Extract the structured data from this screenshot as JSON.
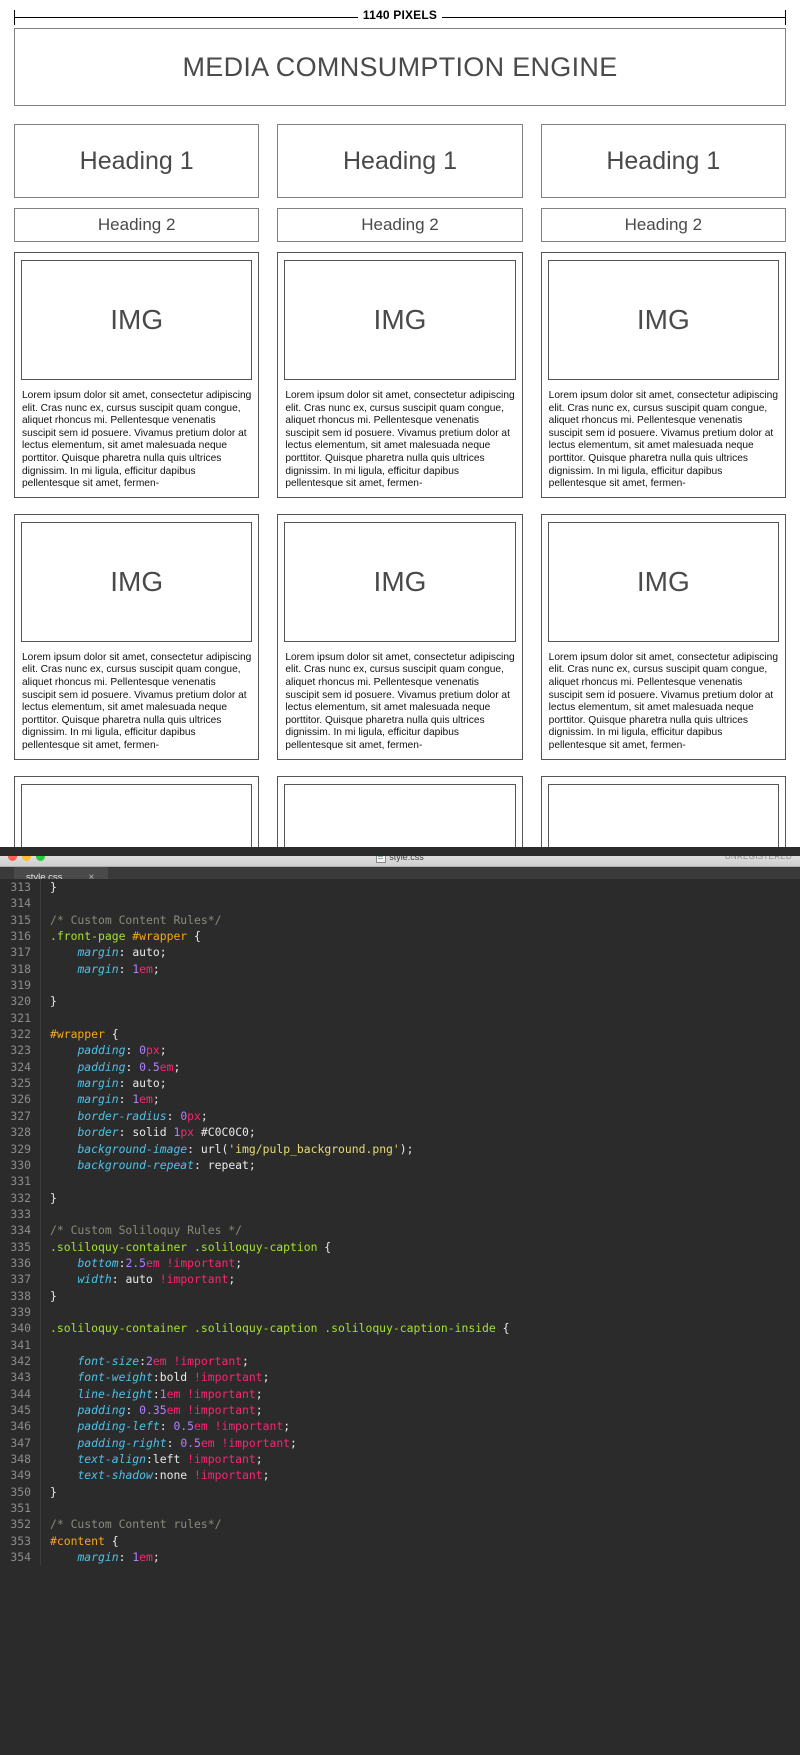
{
  "wireframe": {
    "ruler_label": "1140 PIXELS",
    "title": "MEDIA COMNSUMPTION ENGINE",
    "heading1": "Heading 1",
    "heading2": "Heading 2",
    "img_placeholder": "IMG",
    "body_text": "Lorem ipsum dolor sit amet, consectetur adipiscing elit. Cras nunc ex, cursus suscipit quam congue, aliquet rhoncus mi. Pellentesque venenatis suscipit sem id posuere. Vivamus pretium dolor at lectus elementum, sit amet malesuada neque porttitor. Quisque pharetra nulla quis ultrices dignissim. In mi ligula, efficitur dapibus pellentesque sit amet, fermen-",
    "columns": [
      {
        "heading1": "Heading 1",
        "heading2": "Heading 2"
      },
      {
        "heading1": "Heading 1",
        "heading2": "Heading 2"
      },
      {
        "heading1": "Heading 1",
        "heading2": "Heading 2"
      }
    ]
  },
  "editor": {
    "window_title": "style.css",
    "license_status": "UNREGISTERED",
    "tab_label": "style.css",
    "tab_close": "×",
    "traffic_lights": [
      "close-red",
      "minimize-yellow",
      "zoom-green"
    ],
    "first_visible_line": 313,
    "lines": [
      {
        "num": "313",
        "tokens": [
          {
            "t": "}",
            "c": "tok-punc"
          }
        ],
        "indent": 0
      },
      {
        "num": "314",
        "tokens": [],
        "indent": 0
      },
      {
        "num": "315",
        "tokens": [
          {
            "t": "/* Custom Content Rules*/",
            "c": "tok-comment"
          }
        ],
        "indent": 0
      },
      {
        "num": "316",
        "tokens": [
          {
            "t": ".front-page ",
            "c": "tok-selector-class"
          },
          {
            "t": "#wrapper",
            "c": "tok-selector-id"
          },
          {
            "t": " {",
            "c": "tok-punc"
          }
        ],
        "indent": 0
      },
      {
        "num": "317",
        "tokens": [
          {
            "t": "margin",
            "c": "tok-prop"
          },
          {
            "t": ": ",
            "c": "tok-punc"
          },
          {
            "t": "auto",
            "c": "tok-val"
          },
          {
            "t": ";",
            "c": "tok-punc"
          }
        ],
        "indent": 1
      },
      {
        "num": "318",
        "tokens": [
          {
            "t": "margin",
            "c": "tok-prop"
          },
          {
            "t": ": ",
            "c": "tok-punc"
          },
          {
            "t": "1",
            "c": "tok-num"
          },
          {
            "t": "em",
            "c": "tok-unit"
          },
          {
            "t": ";",
            "c": "tok-punc"
          }
        ],
        "indent": 1
      },
      {
        "num": "319",
        "tokens": [],
        "indent": 0
      },
      {
        "num": "320",
        "tokens": [
          {
            "t": "}",
            "c": "tok-punc"
          }
        ],
        "indent": 0
      },
      {
        "num": "321",
        "tokens": [],
        "indent": 0
      },
      {
        "num": "322",
        "tokens": [
          {
            "t": "#wrapper",
            "c": "tok-selector-id"
          },
          {
            "t": " {",
            "c": "tok-punc"
          }
        ],
        "indent": 0
      },
      {
        "num": "323",
        "tokens": [
          {
            "t": "padding",
            "c": "tok-prop"
          },
          {
            "t": ": ",
            "c": "tok-punc"
          },
          {
            "t": "0",
            "c": "tok-num"
          },
          {
            "t": "px",
            "c": "tok-unit"
          },
          {
            "t": ";",
            "c": "tok-punc"
          }
        ],
        "indent": 1
      },
      {
        "num": "324",
        "tokens": [
          {
            "t": "padding",
            "c": "tok-prop"
          },
          {
            "t": ": ",
            "c": "tok-punc"
          },
          {
            "t": "0.5",
            "c": "tok-num"
          },
          {
            "t": "em",
            "c": "tok-unit"
          },
          {
            "t": ";",
            "c": "tok-punc"
          }
        ],
        "indent": 1
      },
      {
        "num": "325",
        "tokens": [
          {
            "t": "margin",
            "c": "tok-prop"
          },
          {
            "t": ": ",
            "c": "tok-punc"
          },
          {
            "t": "auto",
            "c": "tok-val"
          },
          {
            "t": ";",
            "c": "tok-punc"
          }
        ],
        "indent": 1
      },
      {
        "num": "326",
        "tokens": [
          {
            "t": "margin",
            "c": "tok-prop"
          },
          {
            "t": ": ",
            "c": "tok-punc"
          },
          {
            "t": "1",
            "c": "tok-num"
          },
          {
            "t": "em",
            "c": "tok-unit"
          },
          {
            "t": ";",
            "c": "tok-punc"
          }
        ],
        "indent": 1
      },
      {
        "num": "327",
        "tokens": [
          {
            "t": "border-radius",
            "c": "tok-prop"
          },
          {
            "t": ": ",
            "c": "tok-punc"
          },
          {
            "t": "0",
            "c": "tok-num"
          },
          {
            "t": "px",
            "c": "tok-unit"
          },
          {
            "t": ";",
            "c": "tok-punc"
          }
        ],
        "indent": 1
      },
      {
        "num": "328",
        "tokens": [
          {
            "t": "border",
            "c": "tok-prop"
          },
          {
            "t": ": ",
            "c": "tok-punc"
          },
          {
            "t": "solid ",
            "c": "tok-val"
          },
          {
            "t": "1",
            "c": "tok-num"
          },
          {
            "t": "px",
            "c": "tok-unit"
          },
          {
            "t": " #C0C0C0",
            "c": "tok-val"
          },
          {
            "t": ";",
            "c": "tok-punc"
          }
        ],
        "indent": 1
      },
      {
        "num": "329",
        "tokens": [
          {
            "t": "background-image",
            "c": "tok-prop"
          },
          {
            "t": ": ",
            "c": "tok-punc"
          },
          {
            "t": "url(",
            "c": "tok-func"
          },
          {
            "t": "'img/pulp_background.png'",
            "c": "tok-string"
          },
          {
            "t": ");",
            "c": "tok-punc"
          }
        ],
        "indent": 1
      },
      {
        "num": "330",
        "tokens": [
          {
            "t": "background-repeat",
            "c": "tok-prop"
          },
          {
            "t": ": ",
            "c": "tok-punc"
          },
          {
            "t": "repeat",
            "c": "tok-val"
          },
          {
            "t": ";",
            "c": "tok-punc"
          }
        ],
        "indent": 1
      },
      {
        "num": "331",
        "tokens": [],
        "indent": 0
      },
      {
        "num": "332",
        "tokens": [
          {
            "t": "}",
            "c": "tok-punc"
          }
        ],
        "indent": 0
      },
      {
        "num": "333",
        "tokens": [],
        "indent": 0
      },
      {
        "num": "334",
        "tokens": [
          {
            "t": "/* Custom Soliloquy Rules */",
            "c": "tok-comment"
          }
        ],
        "indent": 0
      },
      {
        "num": "335",
        "tokens": [
          {
            "t": ".soliloquy-container .soliloquy-caption",
            "c": "tok-selector-class"
          },
          {
            "t": " {",
            "c": "tok-punc"
          }
        ],
        "indent": 0
      },
      {
        "num": "336",
        "tokens": [
          {
            "t": "bottom",
            "c": "tok-prop"
          },
          {
            "t": ":",
            "c": "tok-punc"
          },
          {
            "t": "2.5",
            "c": "tok-num"
          },
          {
            "t": "em",
            "c": "tok-unit"
          },
          {
            "t": " !important",
            "c": "tok-imp"
          },
          {
            "t": ";",
            "c": "tok-punc"
          }
        ],
        "indent": 1
      },
      {
        "num": "337",
        "tokens": [
          {
            "t": "width",
            "c": "tok-prop"
          },
          {
            "t": ": ",
            "c": "tok-punc"
          },
          {
            "t": "auto",
            "c": "tok-val"
          },
          {
            "t": " !important",
            "c": "tok-imp"
          },
          {
            "t": ";",
            "c": "tok-punc"
          }
        ],
        "indent": 1
      },
      {
        "num": "338",
        "tokens": [
          {
            "t": "}",
            "c": "tok-punc"
          }
        ],
        "indent": 0
      },
      {
        "num": "339",
        "tokens": [],
        "indent": 0
      },
      {
        "num": "340",
        "tokens": [
          {
            "t": ".soliloquy-container .soliloquy-caption .soliloquy-caption-inside",
            "c": "tok-selector-class"
          },
          {
            "t": " {",
            "c": "tok-punc"
          }
        ],
        "indent": 0
      },
      {
        "num": "341",
        "tokens": [],
        "indent": 0
      },
      {
        "num": "342",
        "tokens": [
          {
            "t": "font-size",
            "c": "tok-prop"
          },
          {
            "t": ":",
            "c": "tok-punc"
          },
          {
            "t": "2",
            "c": "tok-num"
          },
          {
            "t": "em",
            "c": "tok-unit"
          },
          {
            "t": " !important",
            "c": "tok-imp"
          },
          {
            "t": ";",
            "c": "tok-punc"
          }
        ],
        "indent": 1
      },
      {
        "num": "343",
        "tokens": [
          {
            "t": "font-weight",
            "c": "tok-prop"
          },
          {
            "t": ":",
            "c": "tok-punc"
          },
          {
            "t": "bold",
            "c": "tok-val"
          },
          {
            "t": " !important",
            "c": "tok-imp"
          },
          {
            "t": ";",
            "c": "tok-punc"
          }
        ],
        "indent": 1
      },
      {
        "num": "344",
        "tokens": [
          {
            "t": "line-height",
            "c": "tok-prop"
          },
          {
            "t": ":",
            "c": "tok-punc"
          },
          {
            "t": "1",
            "c": "tok-num"
          },
          {
            "t": "em",
            "c": "tok-unit"
          },
          {
            "t": " !important",
            "c": "tok-imp"
          },
          {
            "t": ";",
            "c": "tok-punc"
          }
        ],
        "indent": 1
      },
      {
        "num": "345",
        "tokens": [
          {
            "t": "padding",
            "c": "tok-prop"
          },
          {
            "t": ": ",
            "c": "tok-punc"
          },
          {
            "t": "0.35",
            "c": "tok-num"
          },
          {
            "t": "em",
            "c": "tok-unit"
          },
          {
            "t": " !important",
            "c": "tok-imp"
          },
          {
            "t": ";",
            "c": "tok-punc"
          }
        ],
        "indent": 1
      },
      {
        "num": "346",
        "tokens": [
          {
            "t": "padding-left",
            "c": "tok-prop"
          },
          {
            "t": ": ",
            "c": "tok-punc"
          },
          {
            "t": "0.5",
            "c": "tok-num"
          },
          {
            "t": "em",
            "c": "tok-unit"
          },
          {
            "t": " !important",
            "c": "tok-imp"
          },
          {
            "t": ";",
            "c": "tok-punc"
          }
        ],
        "indent": 1
      },
      {
        "num": "347",
        "tokens": [
          {
            "t": "padding-right",
            "c": "tok-prop"
          },
          {
            "t": ": ",
            "c": "tok-punc"
          },
          {
            "t": "0.5",
            "c": "tok-num"
          },
          {
            "t": "em",
            "c": "tok-unit"
          },
          {
            "t": " !important",
            "c": "tok-imp"
          },
          {
            "t": ";",
            "c": "tok-punc"
          }
        ],
        "indent": 1
      },
      {
        "num": "348",
        "tokens": [
          {
            "t": "text-align",
            "c": "tok-prop"
          },
          {
            "t": ":",
            "c": "tok-punc"
          },
          {
            "t": "left",
            "c": "tok-val"
          },
          {
            "t": " !important",
            "c": "tok-imp"
          },
          {
            "t": ";",
            "c": "tok-punc"
          }
        ],
        "indent": 1
      },
      {
        "num": "349",
        "tokens": [
          {
            "t": "text-shadow",
            "c": "tok-prop"
          },
          {
            "t": ":",
            "c": "tok-punc"
          },
          {
            "t": "none",
            "c": "tok-val"
          },
          {
            "t": " !important",
            "c": "tok-imp"
          },
          {
            "t": ";",
            "c": "tok-punc"
          }
        ],
        "indent": 1
      },
      {
        "num": "350",
        "tokens": [
          {
            "t": "}",
            "c": "tok-punc"
          }
        ],
        "indent": 0
      },
      {
        "num": "351",
        "tokens": [],
        "indent": 0
      },
      {
        "num": "352",
        "tokens": [
          {
            "t": "/* Custom Content rules*/",
            "c": "tok-comment"
          }
        ],
        "indent": 0
      },
      {
        "num": "353",
        "tokens": [
          {
            "t": "#content",
            "c": "tok-selector-id"
          },
          {
            "t": " {",
            "c": "tok-punc"
          }
        ],
        "indent": 0
      },
      {
        "num": "354",
        "tokens": [
          {
            "t": "margin",
            "c": "tok-prop"
          },
          {
            "t": ": ",
            "c": "tok-punc"
          },
          {
            "t": "1",
            "c": "tok-num"
          },
          {
            "t": "em",
            "c": "tok-unit"
          },
          {
            "t": ";",
            "c": "tok-punc"
          }
        ],
        "indent": 1
      }
    ]
  },
  "colors": {
    "editor_background": "#2b2b2b",
    "gutter_text": "#8c8c8c",
    "comment": "#8a8a7e",
    "selector_class": "#a6e22e",
    "selector_id": "#f7a81b",
    "property": "#4fc1e9",
    "number": "#ae81ff",
    "unit_important": "#f92672",
    "string": "#e6db74",
    "wireframe_border": "#808080",
    "wireframe_text": "#4a4a4a"
  }
}
